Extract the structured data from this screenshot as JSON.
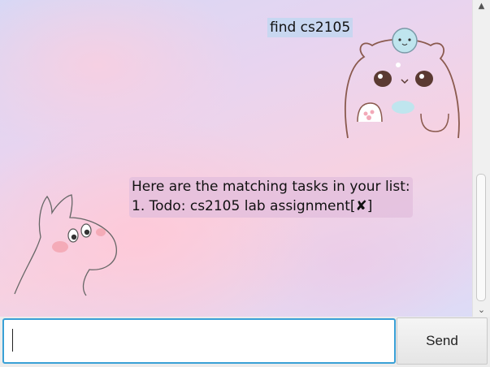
{
  "chat": {
    "messages": [
      {
        "sender": "user",
        "lines": [
          "find cs2105"
        ]
      },
      {
        "sender": "bot",
        "lines": [
          "Here are the matching tasks in your list:",
          "1. Todo:  cs2105 lab assignment[✘]"
        ]
      }
    ]
  },
  "input": {
    "value": "",
    "placeholder": ""
  },
  "send_button": {
    "label": "Send"
  },
  "icons": {
    "user_avatar": "bear-avatar-icon",
    "bot_avatar": "moomin-avatar-icon",
    "scroll_up": "chevron-up-icon",
    "scroll_down": "chevron-down-icon"
  }
}
